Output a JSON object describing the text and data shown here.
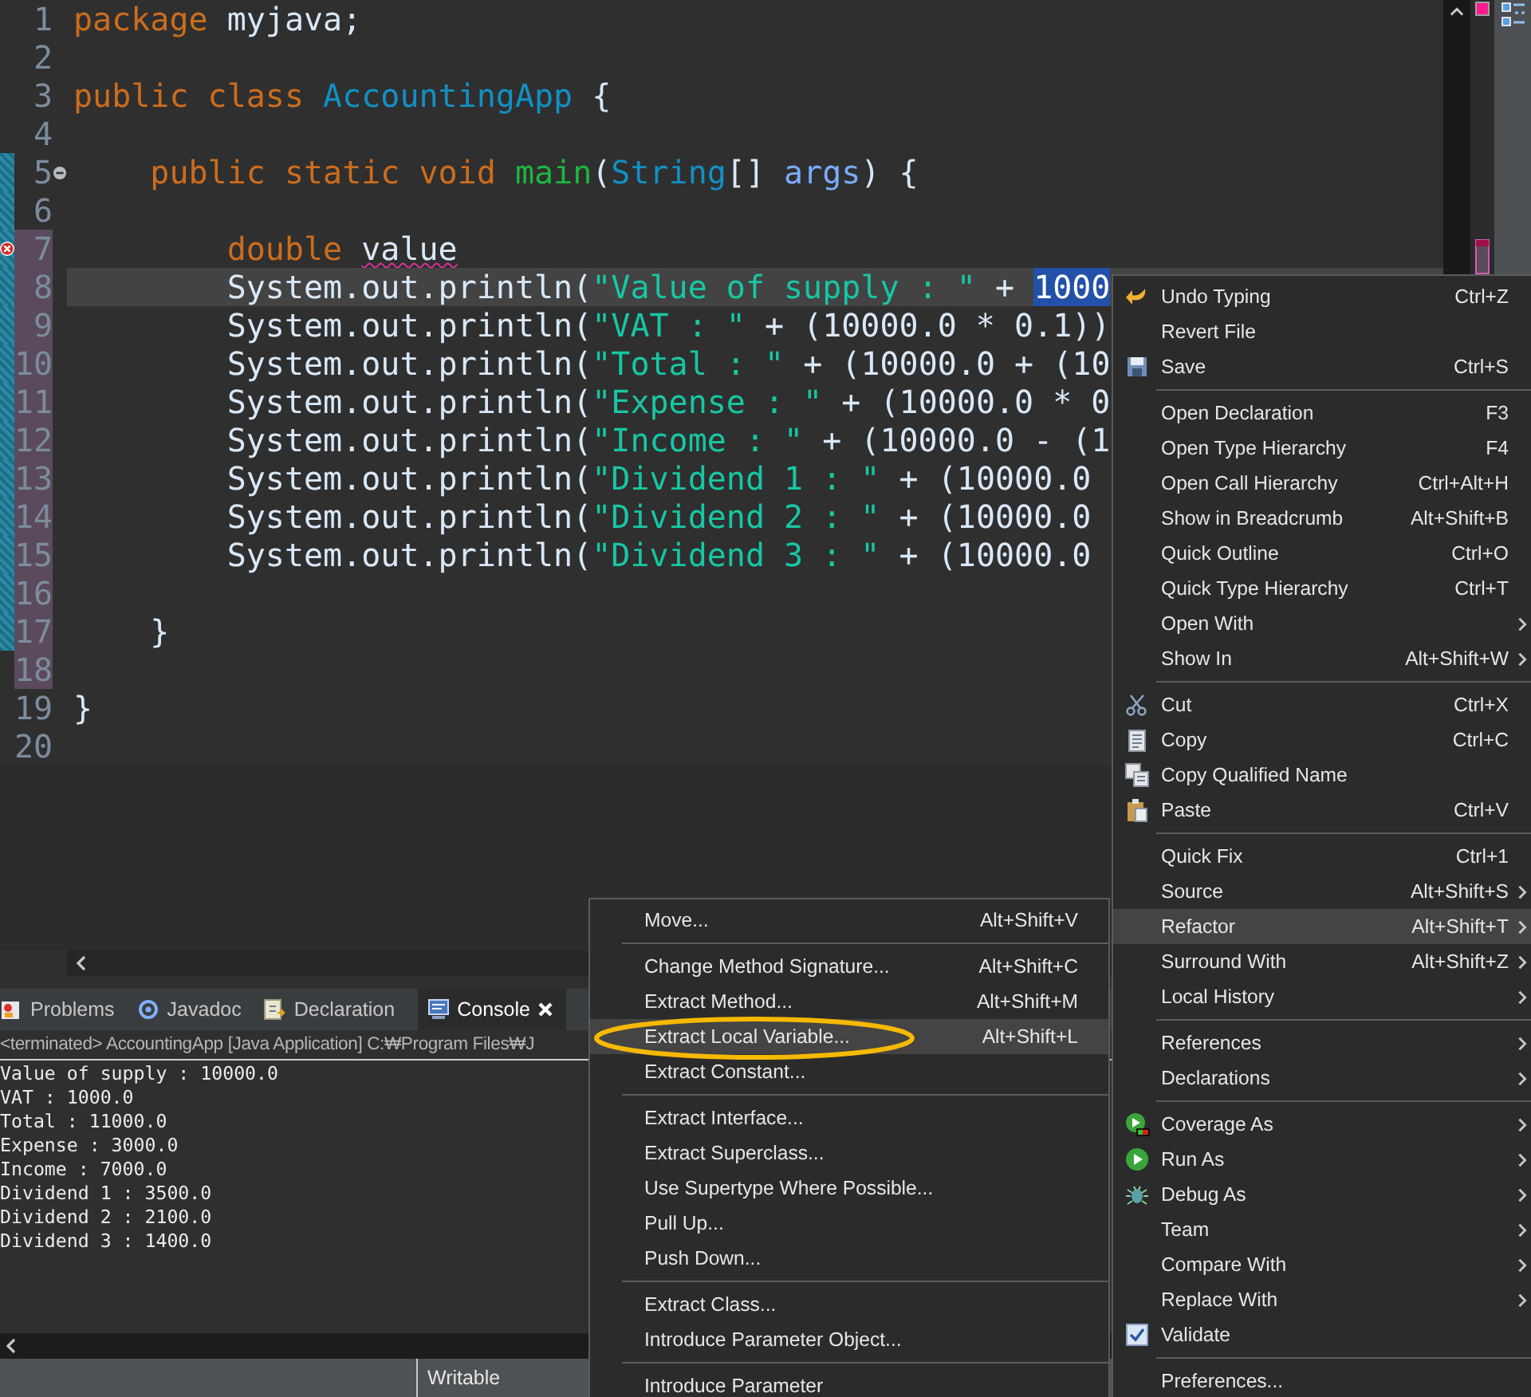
{
  "editor": {
    "lines": [
      {
        "number": "1",
        "range": false,
        "changed": false,
        "error": false,
        "fold": false,
        "current": false,
        "tokens": [
          {
            "kind": "keyword",
            "text": "package"
          },
          {
            "kind": "plain",
            "text": " myjava;"
          }
        ]
      },
      {
        "number": "2",
        "range": false,
        "changed": false,
        "error": false,
        "fold": false,
        "current": false
      },
      {
        "number": "3",
        "range": false,
        "changed": false,
        "error": false,
        "fold": false,
        "current": false,
        "tokens": [
          {
            "kind": "keyword",
            "text": "public class "
          },
          {
            "kind": "type",
            "text": "AccountingApp"
          },
          {
            "kind": "plain",
            "text": " {"
          }
        ]
      },
      {
        "number": "4",
        "range": false,
        "changed": false,
        "error": false,
        "fold": false,
        "current": false
      },
      {
        "number": "5",
        "range": true,
        "changed": false,
        "error": false,
        "fold": true,
        "current": false,
        "tokens": [
          {
            "kind": "keyword",
            "text": "    public static void "
          },
          {
            "kind": "method",
            "text": "main"
          },
          {
            "kind": "plain",
            "text": "("
          },
          {
            "kind": "type",
            "text": "String"
          },
          {
            "kind": "plain",
            "text": "[] "
          },
          {
            "kind": "param",
            "text": "args"
          },
          {
            "kind": "plain",
            "text": ") {"
          }
        ]
      },
      {
        "number": "6",
        "range": true,
        "changed": false,
        "error": false,
        "fold": false,
        "current": false
      },
      {
        "number": "7",
        "range": true,
        "changed": true,
        "error": true,
        "fold": false,
        "current": false,
        "tokens": [
          {
            "kind": "keyword",
            "text": "        double "
          },
          {
            "kind": "error",
            "text": "value"
          }
        ]
      },
      {
        "number": "8",
        "range": true,
        "changed": true,
        "error": false,
        "fold": false,
        "current": true,
        "tokens": [
          {
            "kind": "plain",
            "text": "        System.out.println("
          },
          {
            "kind": "string",
            "text": "\"Value of supply : \""
          },
          {
            "kind": "plain",
            "text": " + "
          },
          {
            "kind": "selected",
            "text": "1000"
          }
        ]
      },
      {
        "number": "9",
        "range": true,
        "changed": true,
        "error": false,
        "fold": false,
        "current": false,
        "tokens": [
          {
            "kind": "plain",
            "text": "        System.out.println("
          },
          {
            "kind": "string",
            "text": "\"VAT : \""
          },
          {
            "kind": "plain",
            "text": " + (10000.0 * 0.1))"
          }
        ]
      },
      {
        "number": "10",
        "range": true,
        "changed": true,
        "error": false,
        "fold": false,
        "current": false,
        "tokens": [
          {
            "kind": "plain",
            "text": "        System.out.println("
          },
          {
            "kind": "string",
            "text": "\"Total : \""
          },
          {
            "kind": "plain",
            "text": " + (10000.0 + (10"
          }
        ]
      },
      {
        "number": "11",
        "range": true,
        "changed": true,
        "error": false,
        "fold": false,
        "current": false,
        "tokens": [
          {
            "kind": "plain",
            "text": "        System.out.println("
          },
          {
            "kind": "string",
            "text": "\"Expense : \""
          },
          {
            "kind": "plain",
            "text": " + (10000.0 * 0"
          }
        ]
      },
      {
        "number": "12",
        "range": true,
        "changed": true,
        "error": false,
        "fold": false,
        "current": false,
        "tokens": [
          {
            "kind": "plain",
            "text": "        System.out.println("
          },
          {
            "kind": "string",
            "text": "\"Income : \""
          },
          {
            "kind": "plain",
            "text": " + (10000.0 - (1"
          }
        ]
      },
      {
        "number": "13",
        "range": true,
        "changed": true,
        "error": false,
        "fold": false,
        "current": false,
        "tokens": [
          {
            "kind": "plain",
            "text": "        System.out.println("
          },
          {
            "kind": "string",
            "text": "\"Dividend 1 : \""
          },
          {
            "kind": "plain",
            "text": " + (10000.0"
          }
        ]
      },
      {
        "number": "14",
        "range": true,
        "changed": true,
        "error": false,
        "fold": false,
        "current": false,
        "tokens": [
          {
            "kind": "plain",
            "text": "        System.out.println("
          },
          {
            "kind": "string",
            "text": "\"Dividend 2 : \""
          },
          {
            "kind": "plain",
            "text": " + (10000.0"
          }
        ]
      },
      {
        "number": "15",
        "range": true,
        "changed": true,
        "error": false,
        "fold": false,
        "current": false,
        "tokens": [
          {
            "kind": "plain",
            "text": "        System.out.println("
          },
          {
            "kind": "string",
            "text": "\"Dividend 3 : \""
          },
          {
            "kind": "plain",
            "text": " + (10000.0"
          }
        ]
      },
      {
        "number": "16",
        "range": true,
        "changed": true,
        "error": false,
        "fold": false,
        "current": false
      },
      {
        "number": "17",
        "range": true,
        "changed": true,
        "error": false,
        "fold": false,
        "current": false,
        "tokens": [
          {
            "kind": "plain",
            "text": "    }"
          }
        ]
      },
      {
        "number": "18",
        "range": false,
        "changed": true,
        "error": false,
        "fold": false,
        "current": false
      },
      {
        "number": "19",
        "range": false,
        "changed": false,
        "error": false,
        "fold": false,
        "current": false,
        "tokens": [
          {
            "kind": "plain",
            "text": "}"
          }
        ]
      },
      {
        "number": "20",
        "range": false,
        "changed": false,
        "error": false,
        "fold": false,
        "current": false
      }
    ]
  },
  "panel": {
    "tabs": [
      {
        "label": "Problems",
        "kind": "problems",
        "selected": false
      },
      {
        "label": "Javadoc",
        "kind": "javadoc",
        "selected": false
      },
      {
        "label": "Declaration",
        "kind": "declaration",
        "selected": false
      },
      {
        "label": "Console",
        "kind": "console",
        "selected": true
      }
    ],
    "console_header": "<terminated> AccountingApp [Java Application] C:₩Program Files₩J",
    "output": [
      "Value of supply : 10000.0",
      "VAT : 1000.0",
      "Total : 11000.0",
      "Expense : 3000.0",
      "Income : 7000.0",
      "Dividend 1 : 3500.0",
      "Dividend 2 : 2100.0",
      "Dividend 3 : 1400.0"
    ]
  },
  "status_bar": {
    "mode": "Writable"
  },
  "context_menu": {
    "groups": [
      {
        "items": [
          {
            "label": "Undo Typing",
            "shortcut": "Ctrl+Z",
            "kind": "undo",
            "submenu": false,
            "selected": false
          },
          {
            "label": "Revert File",
            "kind": "plain",
            "submenu": false,
            "selected": false
          },
          {
            "label": "Save",
            "shortcut": "Ctrl+S",
            "kind": "save",
            "submenu": false,
            "selected": false
          }
        ]
      },
      {
        "items": [
          {
            "label": "Open Declaration",
            "shortcut": "F3",
            "kind": "plain",
            "submenu": false,
            "selected": false
          },
          {
            "label": "Open Type Hierarchy",
            "shortcut": "F4",
            "kind": "plain",
            "submenu": false,
            "selected": false
          },
          {
            "label": "Open Call Hierarchy",
            "shortcut": "Ctrl+Alt+H",
            "kind": "plain",
            "submenu": false,
            "selected": false
          },
          {
            "label": "Show in Breadcrumb",
            "shortcut": "Alt+Shift+B",
            "kind": "plain",
            "submenu": false,
            "selected": false
          },
          {
            "label": "Quick Outline",
            "shortcut": "Ctrl+O",
            "kind": "plain",
            "submenu": false,
            "selected": false
          },
          {
            "label": "Quick Type Hierarchy",
            "shortcut": "Ctrl+T",
            "kind": "plain",
            "submenu": false,
            "selected": false
          },
          {
            "label": "Open With",
            "kind": "plain",
            "submenu": true,
            "selected": false
          },
          {
            "label": "Show In",
            "shortcut": "Alt+Shift+W",
            "kind": "plain",
            "submenu": true,
            "selected": false
          }
        ]
      },
      {
        "items": [
          {
            "label": "Cut",
            "shortcut": "Ctrl+X",
            "kind": "cut",
            "submenu": false,
            "selected": false
          },
          {
            "label": "Copy",
            "shortcut": "Ctrl+C",
            "kind": "copy",
            "submenu": false,
            "selected": false
          },
          {
            "label": "Copy Qualified Name",
            "kind": "copy-name",
            "submenu": false,
            "selected": false
          },
          {
            "label": "Paste",
            "shortcut": "Ctrl+V",
            "kind": "paste",
            "submenu": false,
            "selected": false
          }
        ]
      },
      {
        "items": [
          {
            "label": "Quick Fix",
            "shortcut": "Ctrl+1",
            "kind": "plain",
            "submenu": false,
            "selected": false
          },
          {
            "label": "Source",
            "shortcut": "Alt+Shift+S",
            "kind": "plain",
            "submenu": true,
            "selected": false
          },
          {
            "label": "Refactor",
            "shortcut": "Alt+Shift+T",
            "kind": "plain",
            "submenu": true,
            "selected": true
          },
          {
            "label": "Surround With",
            "shortcut": "Alt+Shift+Z",
            "kind": "plain",
            "submenu": true,
            "selected": false
          },
          {
            "label": "Local History",
            "kind": "plain",
            "submenu": true,
            "selected": false
          }
        ]
      },
      {
        "items": [
          {
            "label": "References",
            "kind": "plain",
            "submenu": true,
            "selected": false
          },
          {
            "label": "Declarations",
            "kind": "plain",
            "submenu": true,
            "selected": false
          }
        ]
      },
      {
        "items": [
          {
            "label": "Coverage As",
            "kind": "coverage",
            "submenu": true,
            "selected": false
          },
          {
            "label": "Run As",
            "kind": "run",
            "submenu": true,
            "selected": false
          },
          {
            "label": "Debug As",
            "kind": "debug",
            "submenu": true,
            "selected": false
          },
          {
            "label": "Team",
            "kind": "plain",
            "submenu": true,
            "selected": false
          },
          {
            "label": "Compare With",
            "kind": "plain",
            "submenu": true,
            "selected": false
          },
          {
            "label": "Replace With",
            "kind": "plain",
            "submenu": true,
            "selected": false
          },
          {
            "label": "Validate",
            "kind": "check",
            "submenu": false,
            "selected": false
          }
        ]
      },
      {
        "items": [
          {
            "label": "Preferences...",
            "kind": "plain",
            "submenu": false,
            "selected": false
          }
        ]
      }
    ]
  },
  "refactor_menu": {
    "groups": [
      {
        "items": [
          {
            "label": "Move...",
            "shortcut": "Alt+Shift+V",
            "selected": false
          }
        ]
      },
      {
        "items": [
          {
            "label": "Change Method Signature...",
            "shortcut": "Alt+Shift+C",
            "selected": false
          },
          {
            "label": "Extract Method...",
            "shortcut": "Alt+Shift+M",
            "selected": false
          },
          {
            "label": "Extract Local Variable...",
            "shortcut": "Alt+Shift+L",
            "selected": true
          },
          {
            "label": "Extract Constant...",
            "selected": false
          }
        ]
      },
      {
        "items": [
          {
            "label": "Extract Interface...",
            "selected": false
          },
          {
            "label": "Extract Superclass...",
            "selected": false
          },
          {
            "label": "Use Supertype Where Possible...",
            "selected": false
          },
          {
            "label": "Pull Up...",
            "selected": false
          },
          {
            "label": "Push Down...",
            "selected": false
          }
        ]
      },
      {
        "items": [
          {
            "label": "Extract Class...",
            "selected": false
          },
          {
            "label": "Introduce Parameter Object...",
            "selected": false
          }
        ]
      },
      {
        "items": [
          {
            "label": "Introduce Parameter",
            "selected": false
          }
        ]
      }
    ]
  }
}
